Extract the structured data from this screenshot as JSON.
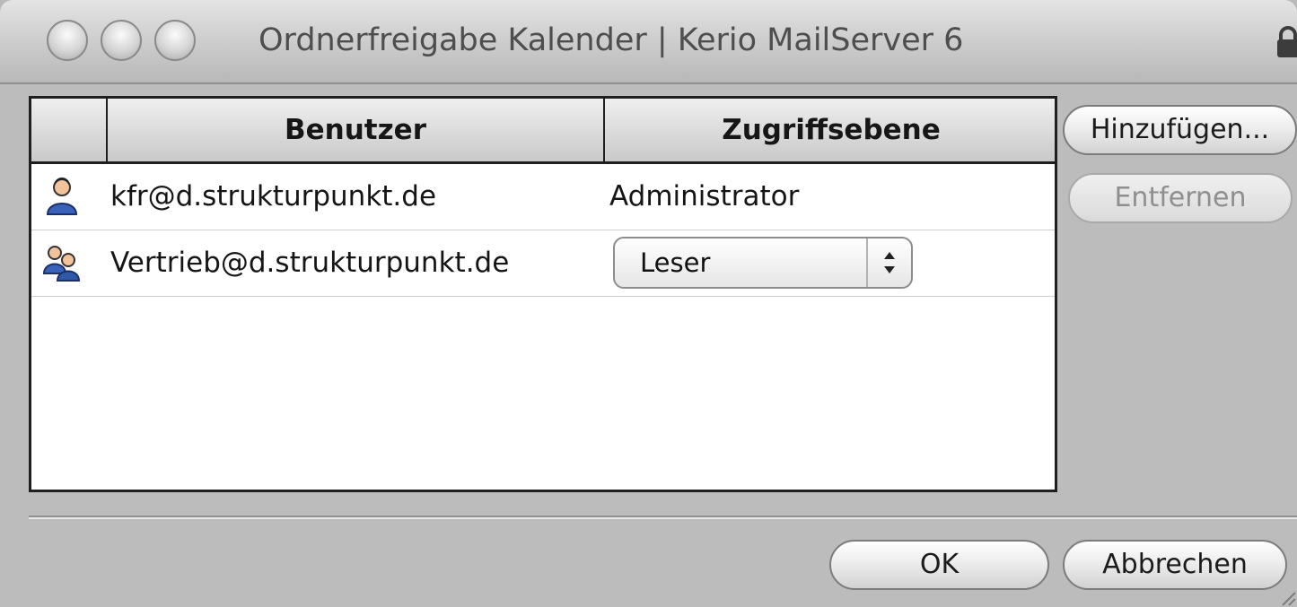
{
  "window": {
    "title": "Ordnerfreigabe Kalender | Kerio MailServer 6"
  },
  "table": {
    "columns": [
      "Benutzer",
      "Zugriffsebene"
    ],
    "rows": [
      {
        "user": "kfr@d.strukturpunkt.de",
        "access": "Administrator",
        "icon": "single-user-icon"
      },
      {
        "user": "Vertrieb@d.strukturpunkt.de",
        "access": "Leser",
        "icon": "group-icon"
      }
    ]
  },
  "side_buttons": {
    "add": "Hinzufügen...",
    "remove": "Entfernen"
  },
  "footer": {
    "ok": "OK",
    "cancel": "Abbrechen"
  }
}
